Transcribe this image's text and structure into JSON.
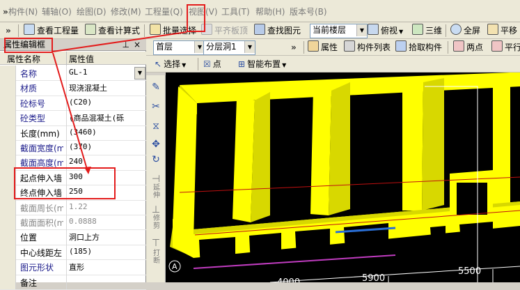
{
  "menubar": {
    "chevron": "»",
    "items": [
      "构件(N)",
      "辅轴(O)",
      "绘图(D)",
      "修改(M)",
      "工程量(Q)",
      "视图(V)",
      "工具(T)",
      "帮助(H)",
      "版本号(B)"
    ]
  },
  "toolbar1": {
    "chevron": "»",
    "view_quantity": "查看工程量",
    "view_formula": "查看计算式",
    "batch_select": "批量选择",
    "align_slab": "平齐板顶",
    "find_element": "查找图元",
    "floor_select": "当前楼层",
    "top_view": "俯视",
    "three_d": "三维",
    "fullscreen": "全屏",
    "pan": "平移"
  },
  "toolbar2": {
    "chevron": "»",
    "floor": "首层",
    "layer": "分层洞1",
    "properties": "属性",
    "component_list": "构件列表",
    "pick_component": "拾取构件",
    "two_points": "两点",
    "parallel": "平行"
  },
  "toolbar3": {
    "select": "选择",
    "point": "点",
    "smart_layout": "智能布置"
  },
  "panel": {
    "title": "属性编辑框",
    "pin": "⊥",
    "close": "×",
    "col_name": "属性名称",
    "col_value": "属性值",
    "rows": [
      {
        "name": "名称",
        "value": "GL-1"
      },
      {
        "name": "材质",
        "value": "现浇混凝土"
      },
      {
        "name": "砼标号",
        "value": "(C20)"
      },
      {
        "name": "砼类型",
        "value": "(商品混凝土(砾"
      },
      {
        "name": "长度(mm)",
        "value": "(3460)"
      },
      {
        "name": "截面宽度(m",
        "value": "(370)"
      },
      {
        "name": "截面高度(m",
        "value": "240"
      },
      {
        "name": "起点伸入墙",
        "value": "300"
      },
      {
        "name": "终点伸入墙",
        "value": "250"
      },
      {
        "name": "截面周长(m",
        "value": "1.22"
      },
      {
        "name": "截面面积(m",
        "value": "0.0888"
      },
      {
        "name": "位置",
        "value": "洞口上方"
      },
      {
        "name": "中心线距左",
        "value": "(185)"
      },
      {
        "name": "图元形状",
        "value": "直形"
      },
      {
        "name": "备注",
        "value": ""
      }
    ]
  },
  "vtoolbar": {
    "label_extend": "延伸",
    "label_trim": "修剪",
    "label_break": "打断"
  },
  "canvas": {
    "dim_5900": "5900",
    "dim_5500": "5500",
    "dim_4000": "4000",
    "axis_a": "A",
    "wall_color": "#ffff00",
    "beam_color": "#2a6fd6"
  }
}
